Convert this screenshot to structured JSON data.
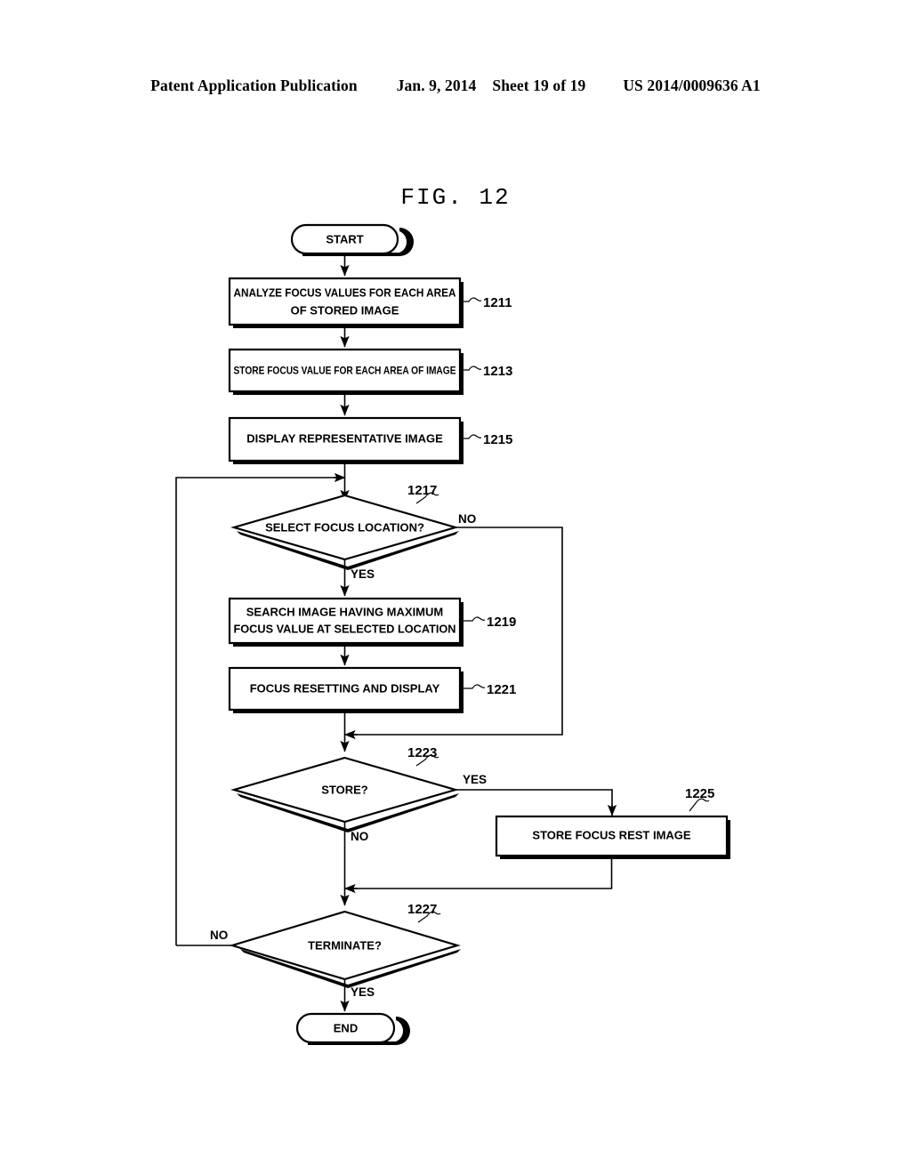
{
  "header": {
    "publication": "Patent Application Publication",
    "date": "Jan. 9, 2014",
    "sheet": "Sheet 19 of 19",
    "patent_number": "US 2014/0009636 A1"
  },
  "figure": {
    "title": "FIG. 12"
  },
  "flowchart": {
    "nodes": [
      {
        "id": "start",
        "type": "terminator",
        "label": "START",
        "ref": ""
      },
      {
        "id": "n1211",
        "type": "process",
        "label": "ANALYZE FOCUS VALUES FOR EACH AREA",
        "label2": "OF STORED IMAGE",
        "ref": "1211"
      },
      {
        "id": "n1213",
        "type": "process",
        "label": "STORE FOCUS VALUE FOR EACH AREA OF IMAGE",
        "ref": "1213"
      },
      {
        "id": "n1215",
        "type": "process",
        "label": "DISPLAY REPRESENTATIVE IMAGE",
        "ref": "1215"
      },
      {
        "id": "n1217",
        "type": "decision",
        "label": "SELECT FOCUS LOCATION?",
        "ref": "1217"
      },
      {
        "id": "n1219",
        "type": "process",
        "label": "SEARCH IMAGE HAVING MAXIMUM",
        "label2": "FOCUS VALUE AT SELECTED LOCATION",
        "ref": "1219"
      },
      {
        "id": "n1221",
        "type": "process",
        "label": "FOCUS RESETTING AND DISPLAY",
        "ref": "1221"
      },
      {
        "id": "n1223",
        "type": "decision",
        "label": "STORE?",
        "ref": "1223"
      },
      {
        "id": "n1225",
        "type": "process",
        "label": "STORE FOCUS REST IMAGE",
        "ref": "1225"
      },
      {
        "id": "n1227",
        "type": "decision",
        "label": "TERMINATE?",
        "ref": "1227"
      },
      {
        "id": "end",
        "type": "terminator",
        "label": "END",
        "ref": ""
      }
    ],
    "edge_labels": {
      "e1217_no": "NO",
      "e1217_yes": "YES",
      "e1223_yes": "YES",
      "e1223_no": "NO",
      "e1227_no": "NO",
      "e1227_yes": "YES"
    },
    "colors": {
      "ink": "#000000",
      "paper": "#ffffff"
    }
  }
}
